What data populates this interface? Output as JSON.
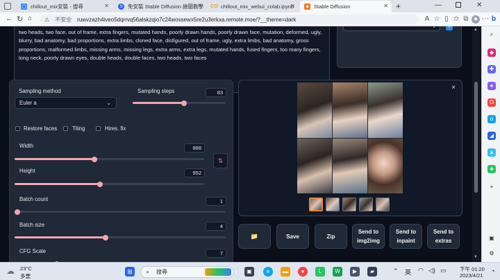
{
  "browser": {
    "tabs": [
      {
        "title": "chillout_mix安裝 - 搜尋",
        "fav_color": "#3b82f6"
      },
      {
        "title": "免安裝 Stable Diffusion 繪圖教學",
        "fav_color": "#2563eb"
      },
      {
        "title": "chillout_mix_webui_colab.ipynb",
        "fav_color": "#f59e0b"
      },
      {
        "title": "Stable Diffusion",
        "fav_color": "#f97316"
      }
    ],
    "new_tab": "+",
    "security_warning": "不安全",
    "url": "ruwvzazh4iveo5dqrrvq56alskzqio7c24wossewx5re2u3erkxa.remote.moe/?__theme=dark"
  },
  "prompt": {
    "negative_text": "two heads, two face, out of frame, extra fingers, mutated hands, poorly drawn hands, poorly drawn face, mutation, deformed, ugly, blurry, bad anatomy, bad proportions, extra limbs, cloned face, disfigured, out of frame, ugly, extra limbs, bad anatomy, gross proportions, malformed limbs, missing arms, missing legs, extra arms, extra legs, mutated hands, fused fingers, too many fingers, long neck, poorly drawn eyes, double heads, double faces, two heads, two faces"
  },
  "settings": {
    "sampling_method_label": "Sampling method",
    "sampling_method_value": "Euler a",
    "sampling_steps_label": "Sampling steps",
    "sampling_steps_value": "83",
    "sampling_steps_fraction": 0.55,
    "restore_faces": "Restore faces",
    "tiling": "Tiling",
    "hires_fix": "Hires. fix",
    "width_label": "Width",
    "width_value": "888",
    "width_fraction": 0.42,
    "height_label": "Height",
    "height_value": "952",
    "height_fraction": 0.45,
    "batch_count_label": "Batch count",
    "batch_count_value": "1",
    "batch_count_fraction": 0.0,
    "batch_size_label": "Batch size",
    "batch_size_value": "4",
    "batch_size_fraction": 0.43,
    "cfg_scale_label": "CFG Scale",
    "cfg_scale_value": "7",
    "cfg_scale_fraction": 0.2,
    "swap_icon": "swap-arrows-icon"
  },
  "output": {
    "close_icon": "×",
    "image_count": 6,
    "thumb_count": 5,
    "buttons": {
      "folder": "📁",
      "save": "Save",
      "zip": "Zip",
      "send_img2img": "Send to img2img",
      "send_inpaint": "Send to inpaint",
      "send_extras": "Send to extras"
    }
  },
  "taskbar": {
    "weather_temp": "23°C",
    "weather_desc": "多雲",
    "search_placeholder": "搜尋",
    "ime": "英",
    "time": "下午 01:20",
    "date": "2023/4/21"
  },
  "colors": {
    "slider": "#f4a6ad",
    "background": "#0b0f19",
    "panel": "#1f2937"
  }
}
